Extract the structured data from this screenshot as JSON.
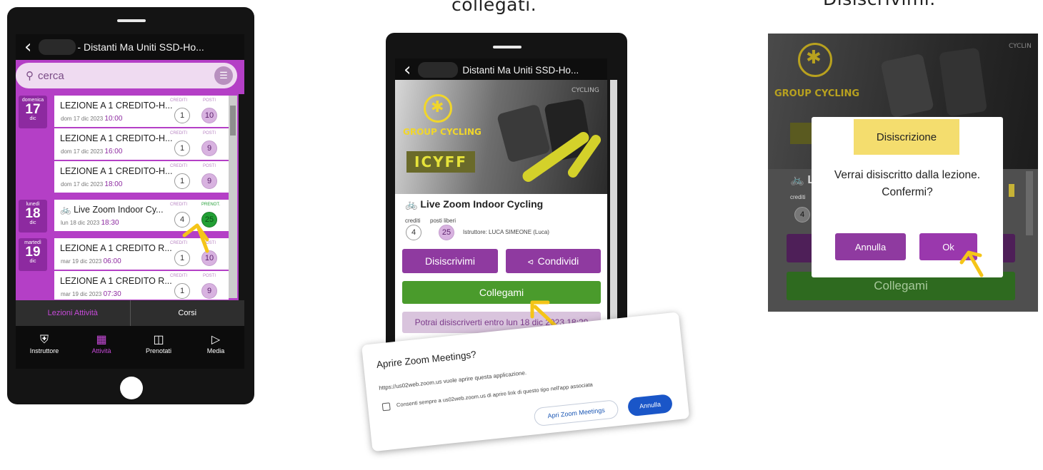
{
  "captions": {
    "middle": "collegati.",
    "right": "Disiscrivimi."
  },
  "phone1": {
    "header_title": "- Distanti Ma Uniti SSD-Ho...",
    "search_placeholder": "cerca",
    "lessons": [
      {
        "day_name": "domenica",
        "day_num": "17",
        "month": "dic",
        "title": "LEZIONE A 1 CREDITO-H...",
        "date": "dom 17 dic 2023",
        "time": "10:00",
        "label1": "CREDITI",
        "credits": "1",
        "label2": "POSTI",
        "slots": "10"
      },
      {
        "title": "LEZIONE A 1 CREDITO-H...",
        "date": "dom 17 dic 2023",
        "time": "16:00",
        "label1": "CREDITI",
        "credits": "1",
        "label2": "POSTI",
        "slots": "9"
      },
      {
        "title": "LEZIONE A 1 CREDITO-H...",
        "date": "dom 17 dic 2023",
        "time": "18:00",
        "label1": "CREDITI",
        "credits": "1",
        "label2": "POSTI",
        "slots": "9"
      },
      {
        "day_name": "lunedì",
        "day_num": "18",
        "month": "dic",
        "title": "Live Zoom Indoor Cy...",
        "date": "lun 18 dic 2023",
        "time": "18:30",
        "label1": "CREDITI",
        "credits": "4",
        "label2": "PRENOT.",
        "slots": "25"
      },
      {
        "day_name": "martedì",
        "day_num": "19",
        "month": "dic",
        "title": "LEZIONE A 1 CREDITO R...",
        "date": "mar 19 dic 2023",
        "time": "06:00",
        "label1": "CREDITI",
        "credits": "1",
        "label2": "POSTI",
        "slots": "10"
      },
      {
        "title": "LEZIONE A 1 CREDITO R...",
        "date": "mar 19 dic 2023",
        "time": "07:30",
        "label1": "CREDITI",
        "credits": "1",
        "label2": "POSTI",
        "slots": "9"
      }
    ],
    "tabs": [
      "Lezioni Attività",
      "Corsi"
    ],
    "nav": [
      {
        "label": "Instruttore",
        "icon": "shield-icon"
      },
      {
        "label": "Attività",
        "icon": "calendar-icon"
      },
      {
        "label": "Prenotati",
        "icon": "bookmark-icon"
      },
      {
        "label": "Media",
        "icon": "video-icon"
      }
    ]
  },
  "phone2": {
    "header_title": "Distanti Ma Uniti SSD-Ho...",
    "banner_logo": "GROUP CYCLING",
    "banner_brand": "ICYFF",
    "banner_corner": "CYCLING",
    "lesson_title": "Live Zoom Indoor Cycling",
    "credits_label": "crediti",
    "slots_label": "posti liberi",
    "credits": "4",
    "slots": "25",
    "instructor": "Istruttore: LUCA SIMEONE (Luca)",
    "btn_unsubscribe": "Disiscrivimi",
    "btn_share": "Condividi",
    "btn_connect": "Collegami",
    "notice": "Potrai disiscriverti entro lun 18 dic 2023 18:29"
  },
  "zoom_dialog": {
    "title": "Aprire Zoom Meetings?",
    "message": "https://us02web.zoom.us vuole aprire questa applicazione.",
    "checkbox_label": "Consenti sempre a us02web.zoom.us di aprire link di questo tipo nell'app associata",
    "btn_open": "Apri Zoom Meetings",
    "btn_cancel": "Annulla"
  },
  "phone3": {
    "banner_logo": "GROUP CYCLING",
    "banner_corner": "CYCLIN",
    "dialog_title": "Disiscrizione",
    "dialog_line1": "Verrai disiscritto dalla lezione.",
    "dialog_line2": "Confermi?",
    "btn_cancel": "Annulla",
    "btn_ok": "Ok",
    "btn_connect": "Collegami",
    "credits": "4",
    "credits_label": "crediti"
  },
  "colors": {
    "brand_purple": "#8f3aa0",
    "list_purple": "#b43fc6",
    "green": "#4a9b2c",
    "arrow_yellow": "#f5c518",
    "logo_yellow": "#f1d62a"
  }
}
